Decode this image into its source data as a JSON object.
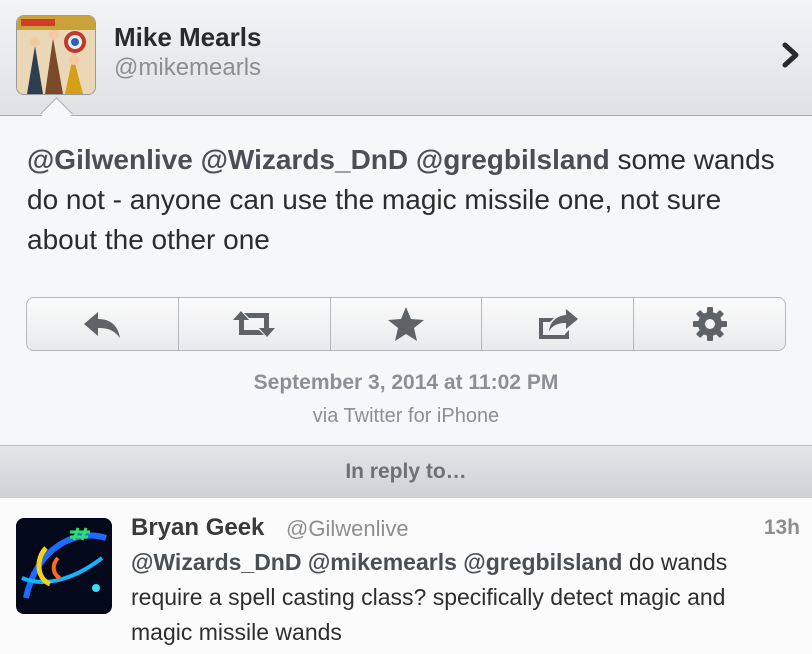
{
  "header": {
    "name": "Mike Mearls",
    "handle": "@mikemearls",
    "avatar_icon": "comic-avatar",
    "chevron_icon": "chevron-right-icon"
  },
  "tweet": {
    "mentions": [
      "@Gilwenlive",
      "@Wizards_DnD",
      "@gregbilsland"
    ],
    "body": "some wands do not - anyone can use the magic missile one, not sure about the other one",
    "timestamp": "September 3, 2014 at 11:02 PM",
    "via": "via Twitter for iPhone"
  },
  "actions": [
    {
      "name": "reply",
      "icon": "reply-icon"
    },
    {
      "name": "retweet",
      "icon": "retweet-icon"
    },
    {
      "name": "favorite",
      "icon": "star-icon"
    },
    {
      "name": "share",
      "icon": "share-icon"
    },
    {
      "name": "more",
      "icon": "gear-icon"
    }
  ],
  "reply_header": "In reply to…",
  "in_reply_to": {
    "name": "Bryan Geek",
    "handle": "@Gilwenlive",
    "time": "13h",
    "mentions": [
      "@Wizards_DnD",
      "@mikemearls",
      "@gregbilsland"
    ],
    "body": "do wands require a spell casting class? specifically detect magic and magic missile wands",
    "avatar_icon": "neon-logo-avatar"
  },
  "colors": {
    "icon": "#5f6367",
    "muted": "#8c8f94"
  }
}
